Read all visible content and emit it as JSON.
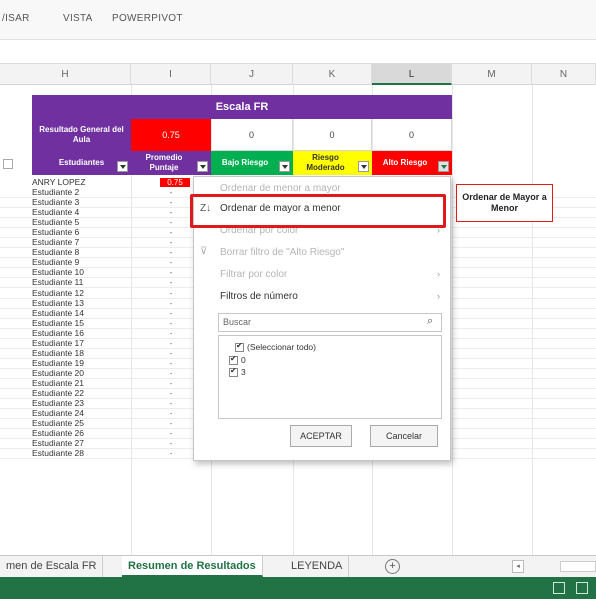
{
  "ribbon": {
    "tabs": [
      "/ISAR",
      "VISTA",
      "POWERPIVOT"
    ]
  },
  "columns": [
    "H",
    "I",
    "J",
    "K",
    "L",
    "M",
    "N"
  ],
  "table": {
    "scale_title": "Escala FR",
    "result_label": "Resultado General del Aula",
    "result_value": "0.75",
    "result_zeros": [
      "0",
      "0",
      "0"
    ],
    "headers": {
      "students": "Estudiantes",
      "average": "Promedio Puntaje",
      "low": "Bajo Riesgo",
      "moderate": "Riesgo Moderado",
      "high": "Alto Riesgo"
    },
    "first_row": {
      "name": "ANRY LOPEZ",
      "value": "0.75",
      "sort_icon": "A↓"
    },
    "rows": [
      "Estudiante 2",
      "Estudiante 3",
      "Estudiante 4",
      "Estudiante 5",
      "Estudiante 6",
      "Estudiante 7",
      "Estudiante 8",
      "Estudiante 9",
      "Estudiante 10",
      "Estudiante 11",
      "Estudiante 12",
      "Estudiante 13",
      "Estudiante 14",
      "Estudiante 15",
      "Estudiante 16",
      "Estudiante 17",
      "Estudiante 18",
      "Estudiante 19",
      "Estudiante 20",
      "Estudiante 21",
      "Estudiante 22",
      "Estudiante 23",
      "Estudiante 24",
      "Estudiante 25",
      "Estudiante 26",
      "Estudiante 27",
      "Estudiante 28"
    ],
    "dash": "-",
    "zero": "0"
  },
  "menu": {
    "sort_asc": "Ordenar de menor a mayor",
    "sort_desc": "Ordenar de mayor a menor",
    "sort_color": "Ordenar por color",
    "clear_filter": "Borrar filtro de \"Alto Riesgo\"",
    "filter_color": "Filtrar por color",
    "number_filters": "Filtros de número",
    "search_placeholder": "Buscar",
    "checklist": [
      "(Seleccionar todo)",
      "0",
      "3"
    ],
    "ok": "ACEPTAR",
    "cancel": "Cancelar",
    "arrow": "›"
  },
  "callout": {
    "text": "Ordenar de Mayor a Menor"
  },
  "sheets": {
    "tabs": [
      "men de Escala FR",
      "Resumen de Resultados",
      "LEYENDA"
    ],
    "add": "+"
  },
  "colors": {
    "purple": "#7030a0",
    "red": "#ff0000",
    "green": "#00b050",
    "yellow": "#ffff00",
    "excel_green": "#217346",
    "highlight": "#e0191d"
  }
}
